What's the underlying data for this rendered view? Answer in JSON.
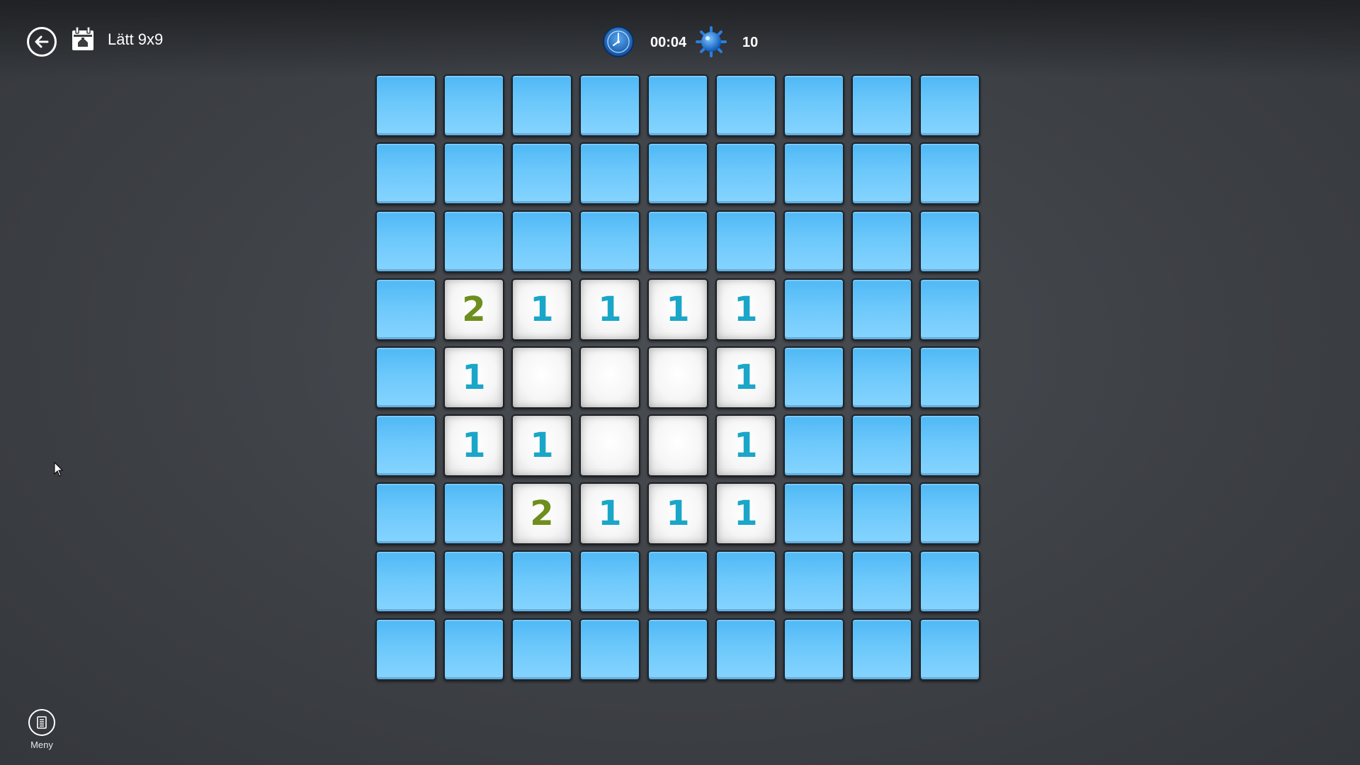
{
  "header": {
    "mode_label": "Lätt 9x9",
    "timer": "00:04",
    "mine_count": "10"
  },
  "icons": {
    "back": "arrow-left-circle",
    "calendar": "calendar-daily-challenge",
    "clock": "clock",
    "mine": "mine",
    "menu": "list-menu"
  },
  "colors": {
    "covered_top": "#4fb8f5",
    "covered_bottom": "#86d4ff",
    "revealed": "#f6f6f6",
    "number_1": "#1aa6c8",
    "number_2": "#6e8e1d"
  },
  "board": {
    "rows": 9,
    "cols": 9,
    "grid": [
      [
        "#",
        "#",
        "#",
        "#",
        "#",
        "#",
        "#",
        "#",
        "#"
      ],
      [
        "#",
        "#",
        "#",
        "#",
        "#",
        "#",
        "#",
        "#",
        "#"
      ],
      [
        "#",
        "#",
        "#",
        "#",
        "#",
        "#",
        "#",
        "#",
        "#"
      ],
      [
        "#",
        "2",
        "1",
        "1",
        "1",
        "1",
        "#",
        "#",
        "#"
      ],
      [
        "#",
        "1",
        "0",
        "0",
        "0",
        "1",
        "#",
        "#",
        "#"
      ],
      [
        "#",
        "1",
        "1",
        "0",
        "0",
        "1",
        "#",
        "#",
        "#"
      ],
      [
        "#",
        "#",
        "2",
        "1",
        "1",
        "1",
        "#",
        "#",
        "#"
      ],
      [
        "#",
        "#",
        "#",
        "#",
        "#",
        "#",
        "#",
        "#",
        "#"
      ],
      [
        "#",
        "#",
        "#",
        "#",
        "#",
        "#",
        "#",
        "#",
        "#"
      ]
    ]
  },
  "appbar": {
    "menu_label": "Meny"
  }
}
